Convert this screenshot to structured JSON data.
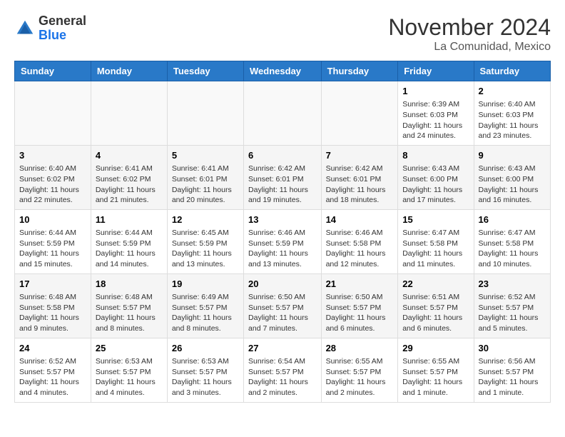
{
  "header": {
    "logo_general": "General",
    "logo_blue": "Blue",
    "month_title": "November 2024",
    "location": "La Comunidad, Mexico"
  },
  "weekdays": [
    "Sunday",
    "Monday",
    "Tuesday",
    "Wednesday",
    "Thursday",
    "Friday",
    "Saturday"
  ],
  "weeks": [
    [
      {
        "day": "",
        "info": ""
      },
      {
        "day": "",
        "info": ""
      },
      {
        "day": "",
        "info": ""
      },
      {
        "day": "",
        "info": ""
      },
      {
        "day": "",
        "info": ""
      },
      {
        "day": "1",
        "info": "Sunrise: 6:39 AM\nSunset: 6:03 PM\nDaylight: 11 hours and 24 minutes."
      },
      {
        "day": "2",
        "info": "Sunrise: 6:40 AM\nSunset: 6:03 PM\nDaylight: 11 hours and 23 minutes."
      }
    ],
    [
      {
        "day": "3",
        "info": "Sunrise: 6:40 AM\nSunset: 6:02 PM\nDaylight: 11 hours and 22 minutes."
      },
      {
        "day": "4",
        "info": "Sunrise: 6:41 AM\nSunset: 6:02 PM\nDaylight: 11 hours and 21 minutes."
      },
      {
        "day": "5",
        "info": "Sunrise: 6:41 AM\nSunset: 6:01 PM\nDaylight: 11 hours and 20 minutes."
      },
      {
        "day": "6",
        "info": "Sunrise: 6:42 AM\nSunset: 6:01 PM\nDaylight: 11 hours and 19 minutes."
      },
      {
        "day": "7",
        "info": "Sunrise: 6:42 AM\nSunset: 6:01 PM\nDaylight: 11 hours and 18 minutes."
      },
      {
        "day": "8",
        "info": "Sunrise: 6:43 AM\nSunset: 6:00 PM\nDaylight: 11 hours and 17 minutes."
      },
      {
        "day": "9",
        "info": "Sunrise: 6:43 AM\nSunset: 6:00 PM\nDaylight: 11 hours and 16 minutes."
      }
    ],
    [
      {
        "day": "10",
        "info": "Sunrise: 6:44 AM\nSunset: 5:59 PM\nDaylight: 11 hours and 15 minutes."
      },
      {
        "day": "11",
        "info": "Sunrise: 6:44 AM\nSunset: 5:59 PM\nDaylight: 11 hours and 14 minutes."
      },
      {
        "day": "12",
        "info": "Sunrise: 6:45 AM\nSunset: 5:59 PM\nDaylight: 11 hours and 13 minutes."
      },
      {
        "day": "13",
        "info": "Sunrise: 6:46 AM\nSunset: 5:59 PM\nDaylight: 11 hours and 13 minutes."
      },
      {
        "day": "14",
        "info": "Sunrise: 6:46 AM\nSunset: 5:58 PM\nDaylight: 11 hours and 12 minutes."
      },
      {
        "day": "15",
        "info": "Sunrise: 6:47 AM\nSunset: 5:58 PM\nDaylight: 11 hours and 11 minutes."
      },
      {
        "day": "16",
        "info": "Sunrise: 6:47 AM\nSunset: 5:58 PM\nDaylight: 11 hours and 10 minutes."
      }
    ],
    [
      {
        "day": "17",
        "info": "Sunrise: 6:48 AM\nSunset: 5:58 PM\nDaylight: 11 hours and 9 minutes."
      },
      {
        "day": "18",
        "info": "Sunrise: 6:48 AM\nSunset: 5:57 PM\nDaylight: 11 hours and 8 minutes."
      },
      {
        "day": "19",
        "info": "Sunrise: 6:49 AM\nSunset: 5:57 PM\nDaylight: 11 hours and 8 minutes."
      },
      {
        "day": "20",
        "info": "Sunrise: 6:50 AM\nSunset: 5:57 PM\nDaylight: 11 hours and 7 minutes."
      },
      {
        "day": "21",
        "info": "Sunrise: 6:50 AM\nSunset: 5:57 PM\nDaylight: 11 hours and 6 minutes."
      },
      {
        "day": "22",
        "info": "Sunrise: 6:51 AM\nSunset: 5:57 PM\nDaylight: 11 hours and 6 minutes."
      },
      {
        "day": "23",
        "info": "Sunrise: 6:52 AM\nSunset: 5:57 PM\nDaylight: 11 hours and 5 minutes."
      }
    ],
    [
      {
        "day": "24",
        "info": "Sunrise: 6:52 AM\nSunset: 5:57 PM\nDaylight: 11 hours and 4 minutes."
      },
      {
        "day": "25",
        "info": "Sunrise: 6:53 AM\nSunset: 5:57 PM\nDaylight: 11 hours and 4 minutes."
      },
      {
        "day": "26",
        "info": "Sunrise: 6:53 AM\nSunset: 5:57 PM\nDaylight: 11 hours and 3 minutes."
      },
      {
        "day": "27",
        "info": "Sunrise: 6:54 AM\nSunset: 5:57 PM\nDaylight: 11 hours and 2 minutes."
      },
      {
        "day": "28",
        "info": "Sunrise: 6:55 AM\nSunset: 5:57 PM\nDaylight: 11 hours and 2 minutes."
      },
      {
        "day": "29",
        "info": "Sunrise: 6:55 AM\nSunset: 5:57 PM\nDaylight: 11 hours and 1 minute."
      },
      {
        "day": "30",
        "info": "Sunrise: 6:56 AM\nSunset: 5:57 PM\nDaylight: 11 hours and 1 minute."
      }
    ]
  ]
}
